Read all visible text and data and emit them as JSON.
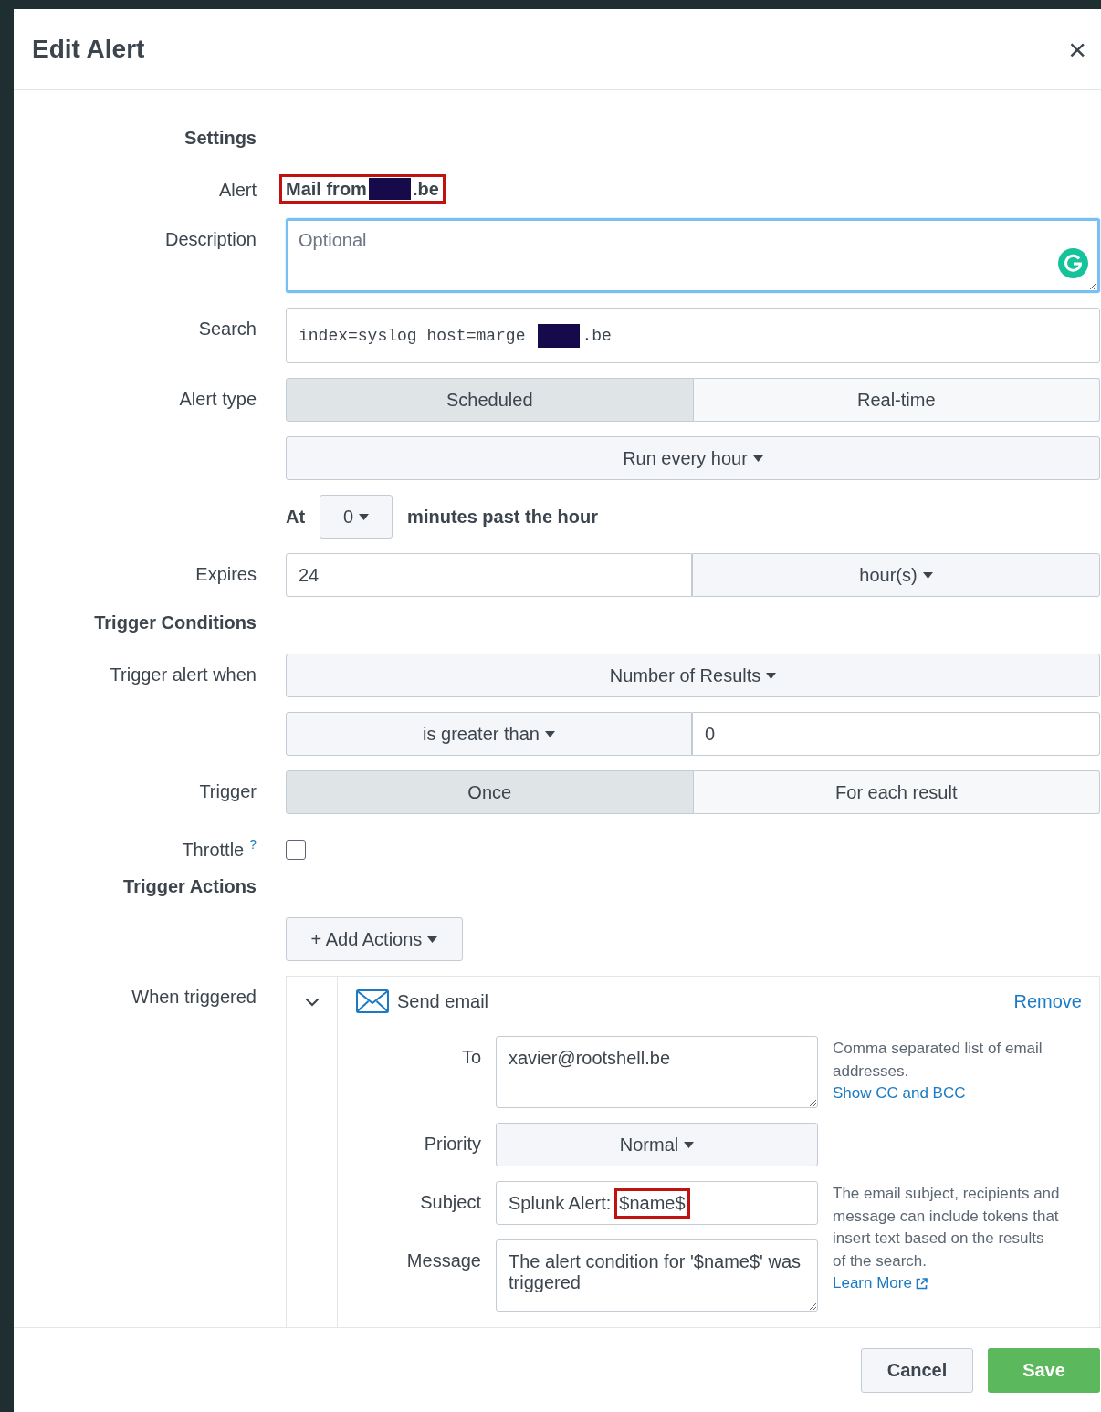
{
  "dialog": {
    "title": "Edit Alert",
    "close": "×"
  },
  "rows": [
    {
      "kind": "heading",
      "label": "Settings"
    },
    {
      "kind": "name",
      "label": "Alert",
      "prefix": "Mail from",
      "suffix": ".be",
      "redacted": true,
      "highlighted": true
    },
    {
      "kind": "textarea",
      "label": "Description",
      "placeholder": "Optional",
      "focused": true
    },
    {
      "kind": "search",
      "label": "Search",
      "prefix": "index=syslog host=marge",
      "suffix": ".be",
      "redacted": true
    },
    {
      "kind": "toggle",
      "label": "Alert type",
      "options": [
        {
          "label": "Scheduled",
          "selected": true
        },
        {
          "label": "Real-time",
          "selected": false
        }
      ]
    },
    {
      "kind": "dropdown",
      "value": "Run every hour"
    },
    {
      "kind": "at",
      "prefix": "At",
      "value": "0",
      "suffix": "minutes past the hour"
    },
    {
      "kind": "input_dropdown",
      "label": "Expires",
      "value": "24",
      "unit": "hour(s)"
    },
    {
      "kind": "heading",
      "label": "Trigger Conditions"
    },
    {
      "kind": "dropdown",
      "label": "Trigger alert when",
      "value": "Number of Results"
    },
    {
      "kind": "dropdown_input",
      "choice": "is greater than",
      "value": "0"
    },
    {
      "kind": "toggle",
      "label": "Trigger",
      "options": [
        {
          "label": "Once",
          "selected": true
        },
        {
          "label": "For each result",
          "selected": false
        }
      ]
    },
    {
      "kind": "checkbox",
      "label": "Throttle",
      "help": "?",
      "checked": false
    },
    {
      "kind": "heading",
      "label": "Trigger Actions"
    },
    {
      "kind": "add_button",
      "value": "+ Add Actions"
    },
    {
      "kind": "action",
      "label": "When triggered",
      "expanded": true,
      "title": "Send email",
      "remove": "Remove",
      "fields": [
        {
          "kind": "textarea",
          "label": "To",
          "value": "xavier@rootshell.be",
          "help": "Comma separated list of email addresses.",
          "link": "Show CC and BCC"
        },
        {
          "kind": "dropdown",
          "label": "Priority",
          "value": "Normal"
        },
        {
          "kind": "subject",
          "label": "Subject",
          "prefix": "Splunk Alert:",
          "token": "$name$",
          "highlighted": true,
          "help": "The email subject, recipients and message can include tokens that insert text based on the results of the search.",
          "link": "Learn More"
        },
        {
          "kind": "textarea",
          "label": "Message",
          "value": "The alert condition for '$name$' was triggered"
        }
      ]
    }
  ],
  "footer": {
    "cancel": "Cancel",
    "save": "Save"
  }
}
